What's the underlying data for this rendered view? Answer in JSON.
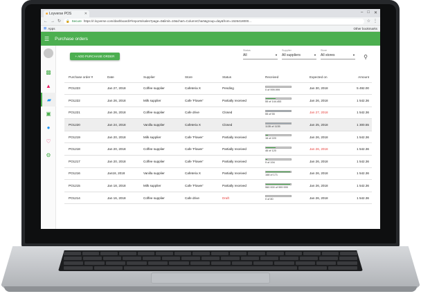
{
  "browser": {
    "tab_title": "Loyverse POS",
    "secure_label": "Secure",
    "url": "https://r.loyverse.com/dashboard/#/reports/sales?page=0&limit=10&chart=ColumnChart&group=day&from=1526418000...",
    "bookmarks": "Apps",
    "other_bookmarks": "Other bookmarks"
  },
  "app": {
    "title": "Purchase orders"
  },
  "toolbar": {
    "add_label": "+ ADD PURCHASE ORDER"
  },
  "filters": {
    "status": {
      "label": "Status",
      "value": "All"
    },
    "supplier": {
      "label": "Supplier",
      "value": "All suppliers"
    },
    "store": {
      "label": "Store",
      "value": "All stores"
    }
  },
  "colors": {
    "accent": "#4caf50",
    "danger": "#e53935"
  },
  "table": {
    "headers": [
      "Purchase order #",
      "Date",
      "Supplier",
      "Store",
      "Status",
      "Received",
      "Expected on",
      "Amount"
    ],
    "rows": [
      {
        "po": "PO1223",
        "date": "Jan 27, 2018",
        "supplier": "Coffee supplier",
        "store": "Cafeteria X",
        "status": "Pending",
        "received": "0 of 999.999",
        "progress": 0.0,
        "expected": "Jan 30, 2018",
        "amount": "5 492.00",
        "highlight": false,
        "late": false,
        "draft": false,
        "grey": false
      },
      {
        "po": "PO1222",
        "date": "Jan 26, 2018",
        "supplier": "Milk supplier",
        "store": "Cafe 'Flower'",
        "status": "Partially received",
        "received": "55 of 144.453",
        "progress": 0.38,
        "expected": "Jan 26, 2018",
        "amount": "1 542.36",
        "highlight": false,
        "late": false,
        "draft": false,
        "grey": false
      },
      {
        "po": "PO1221",
        "date": "Jan 26, 2018",
        "supplier": "Coffee supplier",
        "store": "Cafe drive",
        "status": "Closed",
        "received": "55 of 55",
        "progress": 1.0,
        "expected": "Jan 27, 2018",
        "amount": "1 542.36",
        "highlight": false,
        "late": true,
        "draft": false,
        "grey": true
      },
      {
        "po": "PO1220",
        "date": "Jan 24, 2018",
        "supplier": "Vanilla supplier",
        "store": "Cafeteria X",
        "status": "Closed",
        "received": "1135 of 1135",
        "progress": 1.0,
        "expected": "Jan 25, 2018",
        "amount": "1 300.55",
        "highlight": true,
        "late": false,
        "draft": false,
        "grey": true
      },
      {
        "po": "PO1219",
        "date": "Jan 20, 2018",
        "supplier": "Milk supplier",
        "store": "Cafe 'Flower'",
        "status": "Partially received",
        "received": "16 of 220",
        "progress": 0.07,
        "expected": "Jan 26, 2018",
        "amount": "1 542.36",
        "highlight": false,
        "late": false,
        "draft": false,
        "grey": false
      },
      {
        "po": "PO1218",
        "date": "Jan 20, 2018",
        "supplier": "Coffee supplier",
        "store": "Cafe 'Flower'",
        "status": "Partially received",
        "received": "46 of 120",
        "progress": 0.38,
        "expected": "Jan 26, 2018",
        "amount": "1 542.36",
        "highlight": false,
        "late": true,
        "draft": false,
        "grey": false
      },
      {
        "po": "PO1217",
        "date": "Jan 20, 2018",
        "supplier": "Coffee supplier",
        "store": "Cafe 'Flower'",
        "status": "Partially received",
        "received": "9 of 194",
        "progress": 0.05,
        "expected": "Jan 26, 2018",
        "amount": "1 542.36",
        "highlight": false,
        "late": false,
        "draft": false,
        "grey": false
      },
      {
        "po": "PO1216",
        "date": "Jan18, 2018",
        "supplier": "Vanilla supplier",
        "store": "Cafeteria X",
        "status": "Partially received",
        "received": "168 of 171",
        "progress": 0.98,
        "expected": "Jan 26, 2018",
        "amount": "1 542.36",
        "highlight": false,
        "late": false,
        "draft": false,
        "grey": false
      },
      {
        "po": "PO1215",
        "date": "Jan 18, 2018",
        "supplier": "Milk supplier",
        "store": "Cafe 'Flower'",
        "status": "Partially received",
        "received": "960 000 of 999 999",
        "progress": 0.96,
        "expected": "Jan 26, 2018",
        "amount": "1 542.36",
        "highlight": false,
        "late": false,
        "draft": false,
        "grey": false
      },
      {
        "po": "PO1214",
        "date": "Jan 16, 2018",
        "supplier": "Coffee supplier",
        "store": "Cafe drive",
        "status": "Draft",
        "received": "0 of 80",
        "progress": 0.0,
        "expected": "Jan 26, 2018",
        "amount": "1 542.36",
        "highlight": false,
        "late": false,
        "draft": true,
        "grey": false
      }
    ]
  }
}
